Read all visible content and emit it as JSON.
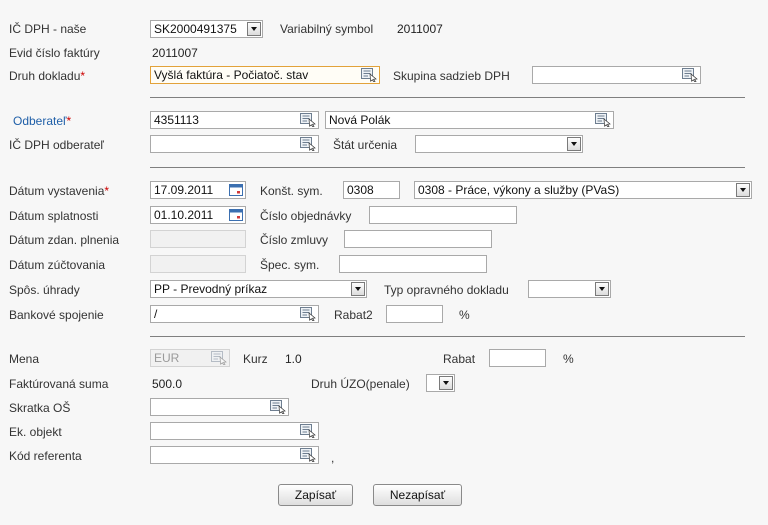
{
  "r1": {
    "ic_dph_label": "IČ DPH - naše",
    "ic_dph_value": "SK2000491375",
    "var_sym_label": "Variabilný symbol",
    "var_sym_value": "2011007"
  },
  "r2": {
    "evid_label": "Evid číslo faktúry",
    "evid_value": "2011007"
  },
  "r3": {
    "druh_label": "Druh dokladu",
    "druh_value": "Vyšlá faktúra - Počiatoč. stav",
    "skupina_label": "Skupina sadzieb DPH",
    "skupina_value": ""
  },
  "r4": {
    "odberatel_label": "Odberateľ",
    "odberatel_code": "4351113",
    "odberatel_name": "Nová Polák"
  },
  "r5": {
    "ic_odb_label": "IČ DPH odberateľ",
    "ic_odb_value": "",
    "stat_label": "Štát určenia",
    "stat_value": ""
  },
  "r6": {
    "datum_vyst_label": "Dátum vystavenia",
    "datum_vyst_value": "17.09.2011",
    "konst_label": "Konšt. sym.",
    "konst_code": "0308",
    "konst_desc": "0308 - Práce, výkony a služby (PVaS)"
  },
  "r7": {
    "datum_spl_label": "Dátum splatnosti",
    "datum_spl_value": "01.10.2011",
    "cislo_obj_label": "Číslo objednávky",
    "cislo_obj_value": ""
  },
  "r8": {
    "datum_zdan_label": "Dátum zdan. plnenia",
    "cislo_zml_label": "Číslo zmluvy",
    "cislo_zml_value": ""
  },
  "r9": {
    "datum_zuct_label": "Dátum zúčtovania",
    "spec_label": "Špec. sym.",
    "spec_value": ""
  },
  "r10": {
    "spos_label": "Spôs. úhrady",
    "spos_value": "PP - Prevodný príkaz",
    "typ_label": "Typ opravného dokladu",
    "typ_value": ""
  },
  "r11": {
    "bank_label": "Bankové spojenie",
    "bank_value": "/",
    "rabat2_label": "Rabat2",
    "rabat2_value": "",
    "pct": "%"
  },
  "r12": {
    "mena_label": "Mena",
    "mena_value": "EUR",
    "kurz_label": "Kurz",
    "kurz_value": "1.0",
    "rabat_label": "Rabat",
    "rabat_value": "",
    "pct": "%"
  },
  "r13": {
    "fakt_label": "Faktúrovaná suma",
    "fakt_value": "500.0",
    "druh_uzo_label": "Druh ÚZO(penale)"
  },
  "r14": {
    "skratka_label": "Skratka OŠ",
    "skratka_value": ""
  },
  "r15": {
    "ek_label": "Ek. objekt",
    "ek_value": ""
  },
  "r16": {
    "kod_label": "Kód referenta",
    "kod_value": "",
    "comma": ","
  },
  "buttons": {
    "save": "Zapísať",
    "cancel": "Nezapísať"
  },
  "required_mark": "*"
}
